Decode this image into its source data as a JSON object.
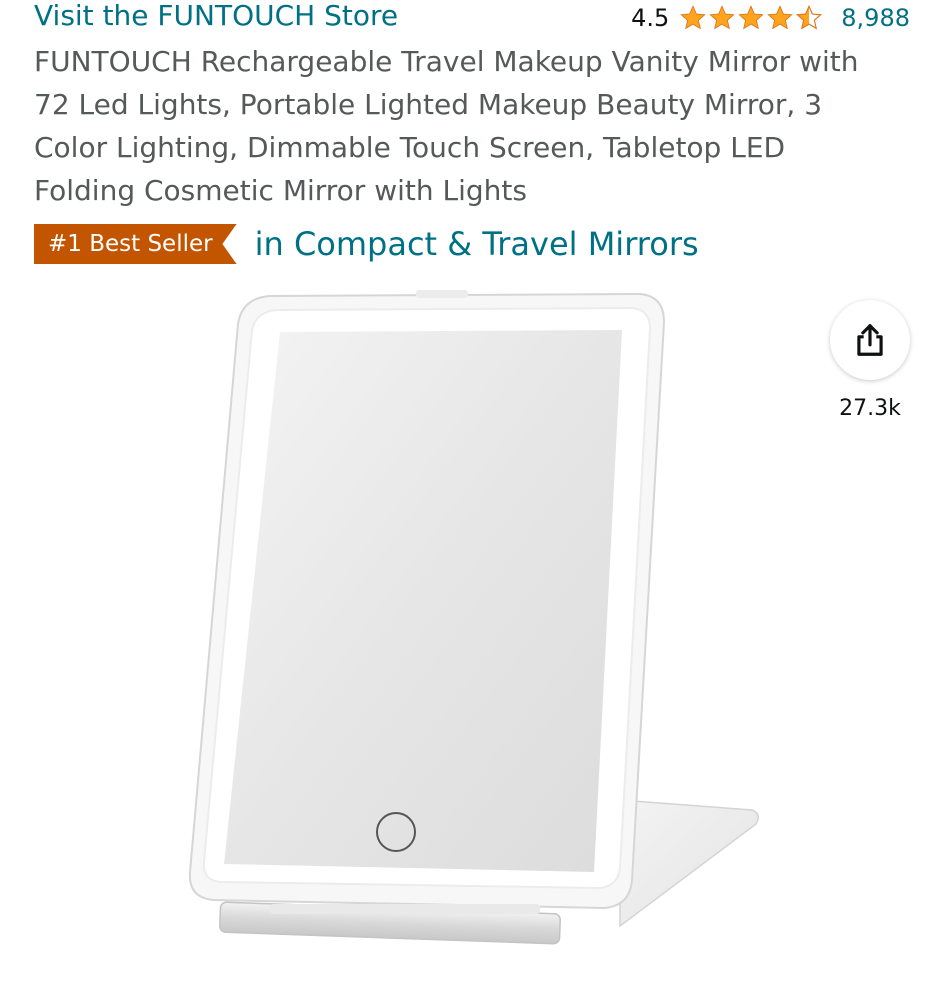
{
  "store": {
    "link_text": "Visit the FUNTOUCH Store"
  },
  "rating": {
    "value": "4.5",
    "stars_out_of_5": 4.5,
    "count": "8,988",
    "star_color": "#ffa41c"
  },
  "product": {
    "title": "FUNTOUCH Rechargeable Travel Makeup Vanity Mirror with 72 Led Lights, Portable Lighted Makeup Beauty Mirror, 3 Color Lighting, Dimmable Touch Screen, Tabletop LED Folding Cosmetic Mirror with Lights",
    "image_icon": "lighted-vanity-mirror"
  },
  "bestseller": {
    "badge": "#1 Best Seller",
    "category": "in Compact & Travel Mirrors",
    "badge_color": "#c45500"
  },
  "share": {
    "icon": "share-icon",
    "count": "27.3k"
  },
  "colors": {
    "link": "#007185",
    "text_secondary": "#565959"
  }
}
